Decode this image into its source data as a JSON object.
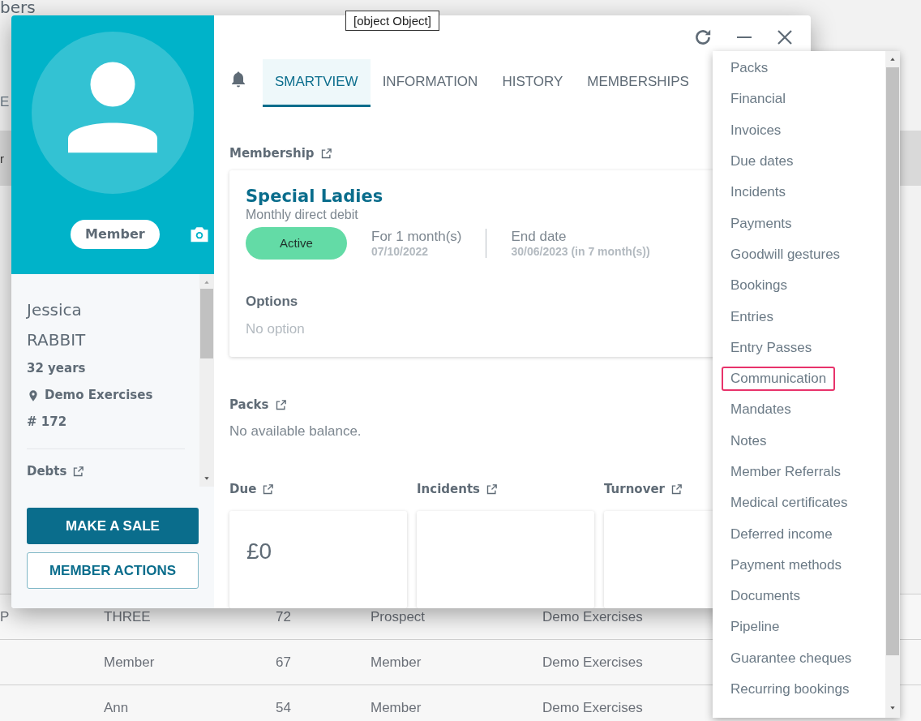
{
  "background": {
    "heading": "bers",
    "fragments": [
      "E",
      "r"
    ],
    "table_rows": [
      {
        "column_1": "P",
        "column_2": "THREE",
        "column_3": "72",
        "column_4": "Prospect",
        "column_5": "Demo Exercises"
      },
      {
        "column_2": "Member",
        "column_3": "67",
        "column_4": "Member",
        "column_5": "Demo Exercises"
      },
      {
        "column_2": "Ann",
        "column_3": "54",
        "column_4": "Member",
        "column_5": "Demo Exercises"
      }
    ]
  },
  "tooltip": "[object Object]",
  "member_panel": {
    "badge": "Member",
    "first_name": "Jessica",
    "last_name": "RABBIT",
    "age": "32 years",
    "club": "Demo Exercises",
    "number": "# 172",
    "debts_label": "Debts",
    "buttons": [
      {
        "label": "MAKE A SALE",
        "kind": "primary"
      },
      {
        "label": "MEMBER ACTIONS",
        "kind": "outline"
      }
    ]
  },
  "tabs": [
    {
      "label": "SMARTVIEW",
      "selected": true
    },
    {
      "label": "INFORMATION",
      "selected": false
    },
    {
      "label": "HISTORY",
      "selected": false
    },
    {
      "label": "MEMBERSHIPS",
      "selected": false
    }
  ],
  "membership": {
    "heading": "Membership",
    "plan": "Special Ladies",
    "payment": "Monthly direct debit",
    "status": "Active",
    "duration": "For 1 month(s)",
    "start_date": "07/10/2022",
    "end_label": "End date",
    "end_date": "30/06/2023 (in 7 month(s))",
    "options_heading": "Options",
    "options_text": "No option"
  },
  "packs": {
    "heading": "Packs",
    "text": "No available balance."
  },
  "summary_cards": [
    {
      "heading": "Due",
      "value": "£0"
    },
    {
      "heading": "Incidents"
    },
    {
      "heading": "Turnover"
    }
  ],
  "menu": {
    "items": [
      {
        "label": "Packs",
        "highlighted": false
      },
      {
        "label": "Financial",
        "highlighted": false
      },
      {
        "label": "Invoices",
        "highlighted": false
      },
      {
        "label": "Due dates",
        "highlighted": false
      },
      {
        "label": "Incidents",
        "highlighted": false
      },
      {
        "label": "Payments",
        "highlighted": false
      },
      {
        "label": "Goodwill gestures",
        "highlighted": false
      },
      {
        "label": "Bookings",
        "highlighted": false
      },
      {
        "label": "Entries",
        "highlighted": false
      },
      {
        "label": "Entry Passes",
        "highlighted": false
      },
      {
        "label": "Communication",
        "highlighted": true
      },
      {
        "label": "Mandates",
        "highlighted": false
      },
      {
        "label": "Notes",
        "highlighted": false
      },
      {
        "label": "Member Referrals",
        "highlighted": false
      },
      {
        "label": "Medical certificates",
        "highlighted": false
      },
      {
        "label": "Deferred income",
        "highlighted": false
      },
      {
        "label": "Payment methods",
        "highlighted": false
      },
      {
        "label": "Documents",
        "highlighted": false
      },
      {
        "label": "Pipeline",
        "highlighted": false
      },
      {
        "label": "Guarantee cheques",
        "highlighted": false
      },
      {
        "label": "Recurring bookings",
        "highlighted": false
      }
    ]
  }
}
